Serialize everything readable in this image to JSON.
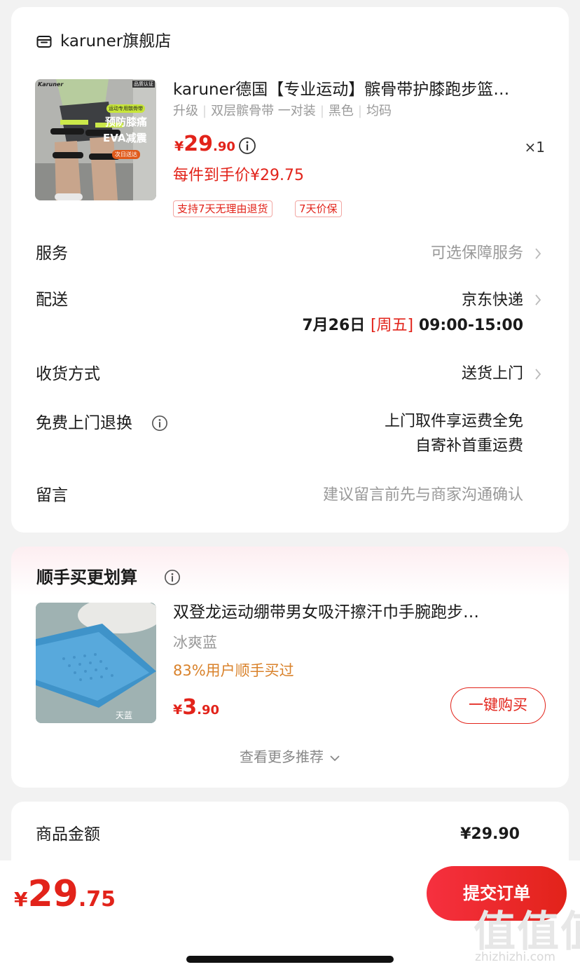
{
  "store": {
    "name": "karuner旗舰店",
    "icon": "store-icon"
  },
  "product": {
    "title": "karuner德国【专业运动】髌骨带护膝跑步篮…",
    "spec": [
      "升级",
      "双层髌骨带 一对装",
      "黑色",
      "均码"
    ],
    "price": {
      "currency": "¥",
      "int": "29",
      "dec": ".90"
    },
    "qty": "×1",
    "hand_price": "每件到手价¥29.75",
    "tags": [
      "支持7天无理由退货",
      "7天价保"
    ],
    "image": {
      "brand": "Karuner",
      "badge": "品质认证",
      "promo_label": "运动专用髌骨带",
      "promo_line1": "预防膝痛",
      "promo_line2": "EVA减震",
      "promo_pill": "次日送达"
    }
  },
  "rows": {
    "service": {
      "label": "服务",
      "value": "可选保障服务"
    },
    "delivery": {
      "label": "配送",
      "value": "京东快递",
      "date": "7月26日",
      "weekday": "[周五]",
      "time": "09:00-15:00"
    },
    "receive": {
      "label": "收货方式",
      "value": "送货上门"
    },
    "return": {
      "label": "免费上门退换",
      "value_line1": "上门取件享运费全免",
      "value_line2": "自寄补首重运费"
    },
    "message": {
      "label": "留言",
      "placeholder": "建议留言前先与商家沟通确认"
    }
  },
  "recommend": {
    "title": "顺手买更划算",
    "item": {
      "name": "双登龙运动绷带男女吸汗擦汗巾手腕跑步…",
      "spec": "冰爽蓝",
      "percent": "83%用户顺手买过",
      "price": {
        "currency": "¥",
        "int": "3",
        "dec": ".90"
      },
      "image_label": "天蓝"
    },
    "buy_label": "一键购买",
    "more_label": "查看更多推荐"
  },
  "summary": {
    "label": "商品金额",
    "value": "¥29.90"
  },
  "bottom": {
    "total": {
      "currency": "¥",
      "int": "29",
      "dec": ".75"
    },
    "submit_label": "提交订单"
  },
  "watermark": {
    "text": "值值值",
    "url": "zhizhizhi.com"
  },
  "colors": {
    "accent": "#e2231a",
    "orange": "#d9822b",
    "gray_text": "#999999",
    "background": "#f2f2f2"
  }
}
